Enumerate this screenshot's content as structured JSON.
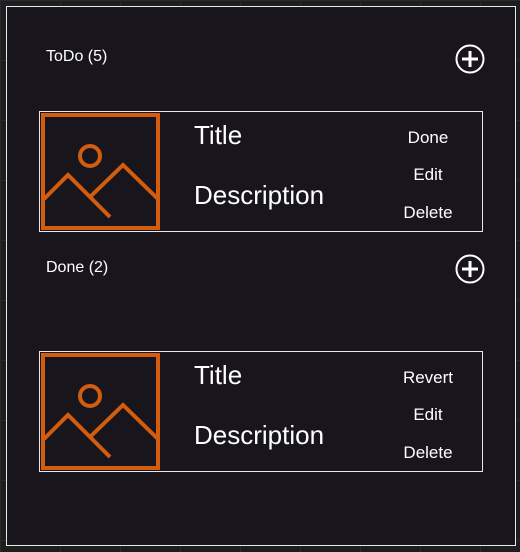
{
  "sections": {
    "todo": {
      "header": "ToDo (5)",
      "card": {
        "title": "Title",
        "description": "Description",
        "actions": [
          "Done",
          "Edit",
          "Delete"
        ]
      }
    },
    "done": {
      "header": "Done (2)",
      "card": {
        "title": "Title",
        "description": "Description",
        "actions": [
          "Revert",
          "Edit",
          "Delete"
        ]
      }
    }
  },
  "colors": {
    "panel_bg": "#18151d",
    "accent_orange": "#d35d0e",
    "text": "#ffffff",
    "border": "#e8e8e8"
  },
  "icons": {
    "add": "plus-circle-icon",
    "thumbnail": "image-placeholder-icon"
  }
}
